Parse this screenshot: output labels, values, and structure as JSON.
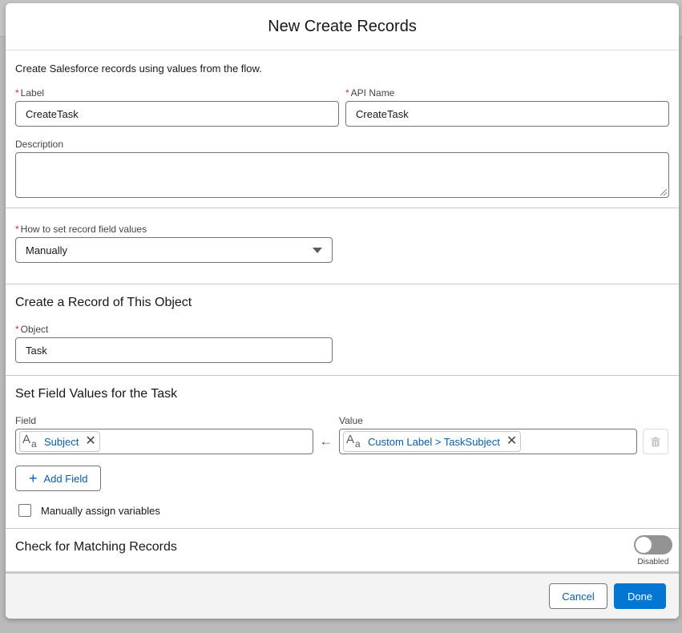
{
  "modal": {
    "title": "New Create Records"
  },
  "intro": {
    "text": "Create Salesforce records using values from the flow.",
    "label_label": "Label",
    "label_value": "CreateTask",
    "api_label": "API Name",
    "api_value": "CreateTask",
    "description_label": "Description",
    "description_value": ""
  },
  "how": {
    "label": "How to set record field values",
    "selected": "Manually"
  },
  "object_section": {
    "title": "Create a Record of This Object",
    "object_label": "Object",
    "object_value": "Task"
  },
  "fields_section": {
    "title": "Set Field Values for the Task",
    "field_header": "Field",
    "value_header": "Value",
    "rows": [
      {
        "field": "Subject",
        "value": "Custom Label > TaskSubject"
      }
    ],
    "add_field_label": "Add Field",
    "manual_assign_label": "Manually assign variables",
    "manual_assign_checked": false
  },
  "matching": {
    "title": "Check for Matching Records",
    "toggle_state": "Disabled"
  },
  "footer": {
    "cancel_label": "Cancel",
    "done_label": "Done"
  },
  "colors": {
    "brand": "#0176d3",
    "link": "#0b5cab",
    "required": "#c23934"
  }
}
